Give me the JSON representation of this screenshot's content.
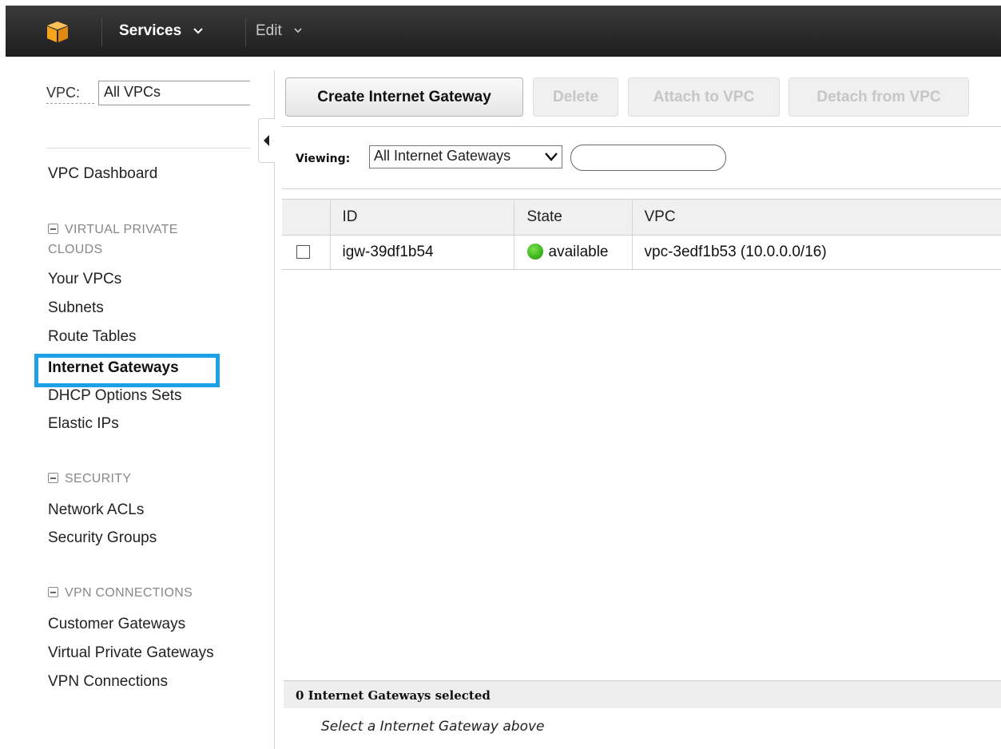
{
  "topbar": {
    "services_label": "Services",
    "edit_label": "Edit",
    "logo_color": "#f7a41d",
    "background": "#2b2b2b"
  },
  "sidebar": {
    "vpc_filter_label": "VPC:",
    "vpc_filter_value": "All VPCs",
    "dashboard_label": "VPC Dashboard",
    "sections": [
      {
        "title": "VIRTUAL PRIVATE CLOUDS",
        "title_line1": "VIRTUAL PRIVATE",
        "title_line2": "CLOUDS",
        "items": [
          "Your VPCs",
          "Subnets",
          "Route Tables",
          "Internet Gateways",
          "DHCP Options Sets",
          "Elastic IPs"
        ]
      },
      {
        "title": "SECURITY",
        "items": [
          "Network ACLs",
          "Security Groups"
        ]
      },
      {
        "title": "VPN CONNECTIONS",
        "items": [
          "Customer Gateways",
          "Virtual Private Gateways",
          "VPN Connections"
        ]
      }
    ],
    "active_item": "Internet Gateways",
    "highlight_color": "#1ea0e6"
  },
  "toolbar": {
    "create_label": "Create Internet Gateway",
    "delete_label": "Delete",
    "attach_label": "Attach to VPC",
    "detach_label": "Detach from VPC"
  },
  "filter": {
    "viewing_label": "Viewing:",
    "viewing_value": "All Internet Gateways",
    "search_value": ""
  },
  "table": {
    "columns": [
      "ID",
      "State",
      "VPC"
    ],
    "rows": [
      {
        "id": "igw-39df1b54",
        "state": "available",
        "vpc": "vpc-3edf1b53 (10.0.0.0/16)",
        "state_color": "#3cb51c"
      }
    ]
  },
  "details": {
    "selected_count_text": "0 Internet Gateways selected",
    "hint_text": "Select a Internet Gateway above"
  }
}
